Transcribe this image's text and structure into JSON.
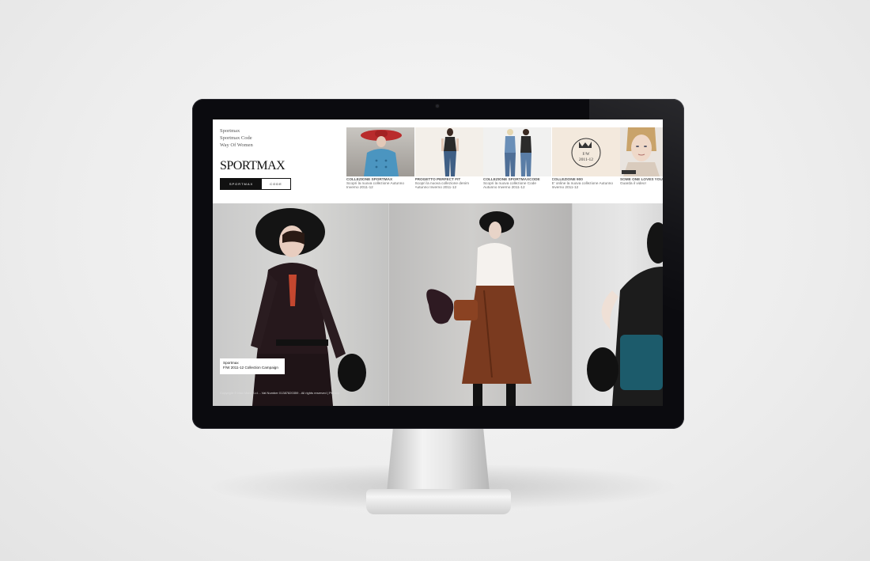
{
  "nav": {
    "links": [
      "Sportmax",
      "Sportmax Code",
      "Way Of Women"
    ]
  },
  "logo": "SPORTMAX",
  "tabs": [
    "SPORTMAX",
    "CODE"
  ],
  "thumbnails": [
    {
      "title": "COLLEZIONE SPORTMAX",
      "text_lines": [
        "Scopri la nuova collezione Autunno",
        "Inverno 2011-12"
      ]
    },
    {
      "title": "PROGETTO PERFECT FIT",
      "text_lines": [
        "Scopri la nuova collezione denim",
        "Autunno Inverno 2011-12"
      ]
    },
    {
      "title": "COLLEZIONE SPORTMAXCODE",
      "text_lines": [
        "Scopri la nuova collezione Code",
        "Autunno Inverno 2011-12"
      ]
    },
    {
      "title": "COLLEZIONE 900",
      "text_lines": [
        "E' online la nuova collezione Autunno",
        "Inverno 2011-12"
      ],
      "badge": {
        "season": "F/W",
        "year": "2011-12"
      }
    },
    {
      "title": "SOME ONE LOVES YOU",
      "text_lines": [
        "Guarda il video!"
      ]
    }
  ],
  "campaign": {
    "caption_line1": "Sportmax",
    "caption_line2": "F/W 2011-12 Collection Campaign"
  },
  "footer": {
    "copyright": "Copyright © Max Mara S.r.l. - Vat Number 01387820359 - All rights reserved | Privacy"
  },
  "colors": {
    "accent": "#111111",
    "hat_red": "#b92c2c",
    "coat_blue": "#4b95c0",
    "skirt_brown": "#7a3a1f",
    "bag_teal": "#1c5b6b"
  }
}
